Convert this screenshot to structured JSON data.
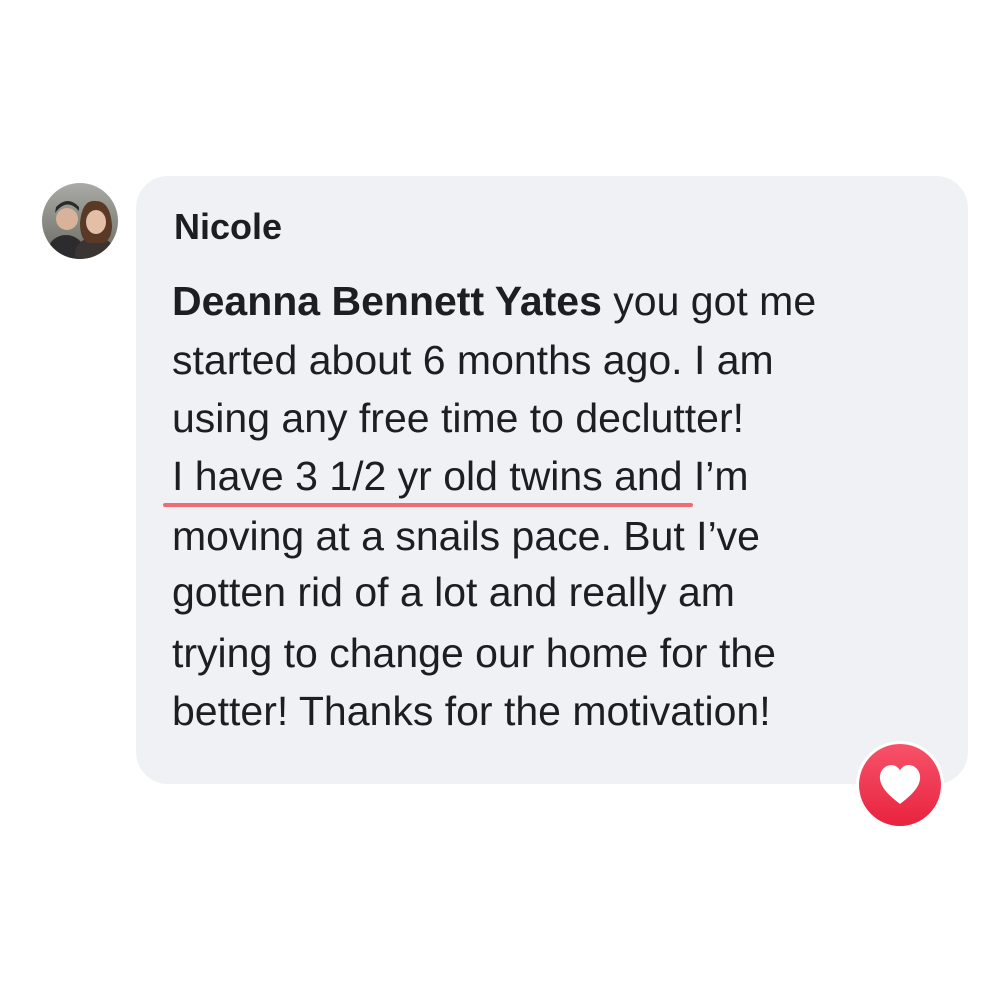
{
  "comment": {
    "author": "Nicole",
    "mention": "Deanna Bennett Yates",
    "lines": [
      " you got me",
      "started about 6 months ago. I am",
      "using any free time to declutter!",
      "I have 3 1/2 yr old twins and I’m",
      "moving at a snails pace. But I’ve",
      "gotten rid of a lot and really am",
      "trying to change our home for the",
      "better! Thanks for the motivation!"
    ],
    "reaction_icon": "heart-icon"
  },
  "colors": {
    "bubble": "#f0f1f4",
    "text": "#1c1e21",
    "underline": "#f26b74",
    "reaction": "#f0284a"
  }
}
